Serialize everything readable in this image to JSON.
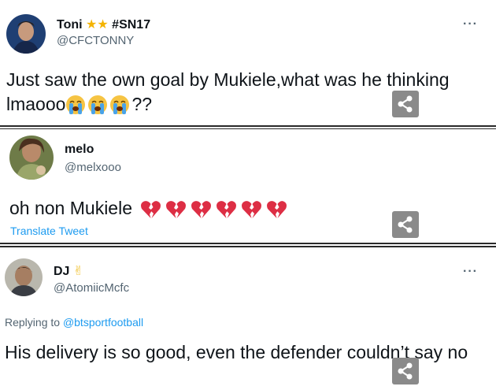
{
  "tweets": [
    {
      "name": "Toni",
      "name_suffix": "#SN17",
      "badges": [
        "star-icon",
        "star-icon"
      ],
      "handle": "@CFCTONNY",
      "text": "Just saw the own goal by Mukiele,what was he thinking lmaooo",
      "text_suffix": "??",
      "emojis": [
        "crying-face-icon",
        "crying-face-icon",
        "crying-face-icon"
      ],
      "more": "···"
    },
    {
      "name": "melo",
      "handle": "@melxooo",
      "text": "oh non Mukiele",
      "emojis": [
        "broken-heart-icon",
        "broken-heart-icon",
        "broken-heart-icon",
        "broken-heart-icon",
        "broken-heart-icon",
        "broken-heart-icon"
      ],
      "translate": "Translate Tweet"
    },
    {
      "name": "DJ",
      "badge": "victory-hand-icon",
      "handle": "@AtomiicMcfc",
      "replying_prefix": "Replying to",
      "replying_to": "@btsportfootball",
      "text": "His delivery is so good, even the defender couldn’t say no",
      "more": "···"
    }
  ],
  "share_icon": "share-icon",
  "colors": {
    "accent": "#1d9bf0",
    "share_bg": "#8a8a8a",
    "star": "#f4b400",
    "heart": "#e0245e"
  }
}
